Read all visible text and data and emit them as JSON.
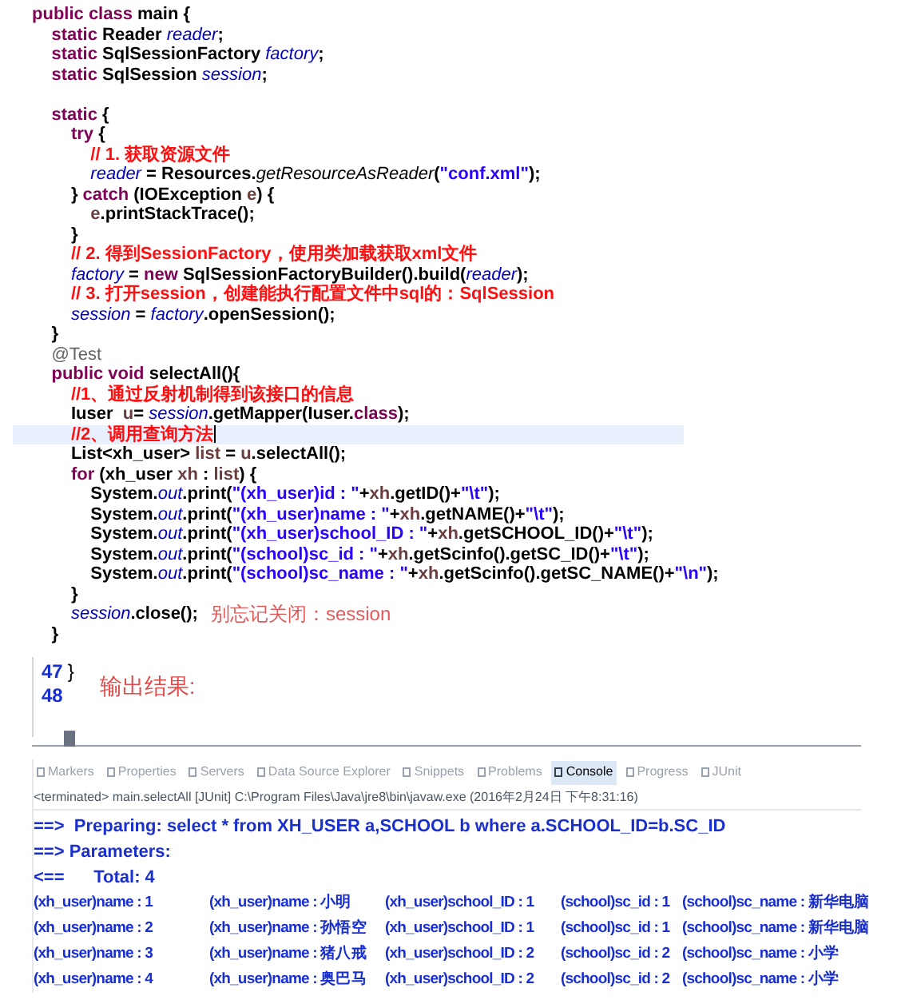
{
  "code_lines": [
    {
      "kind": "code",
      "highlighted": false,
      "tokens": [
        {
          "kind": "kw",
          "text": "public class "
        },
        {
          "kind": "tx",
          "text": "main {"
        }
      ]
    },
    {
      "kind": "code",
      "highlighted": false,
      "tokens": [
        {
          "kind": "kw",
          "text": "    static "
        },
        {
          "kind": "tx",
          "text": "Reader "
        },
        {
          "kind": "fld",
          "text": "reader"
        },
        {
          "kind": "tx",
          "text": ";"
        }
      ]
    },
    {
      "kind": "code",
      "highlighted": false,
      "tokens": [
        {
          "kind": "kw",
          "text": "    static "
        },
        {
          "kind": "tx",
          "text": "SqlSessionFactory "
        },
        {
          "kind": "fld",
          "text": "factory"
        },
        {
          "kind": "tx",
          "text": ";"
        }
      ]
    },
    {
      "kind": "code",
      "highlighted": false,
      "tokens": [
        {
          "kind": "kw",
          "text": "    static "
        },
        {
          "kind": "tx",
          "text": "SqlSession "
        },
        {
          "kind": "fld",
          "text": "session"
        },
        {
          "kind": "tx",
          "text": ";"
        }
      ]
    },
    {
      "kind": "blank"
    },
    {
      "kind": "code",
      "highlighted": false,
      "tokens": [
        {
          "kind": "kw",
          "text": "    static "
        },
        {
          "kind": "tx",
          "text": "{"
        }
      ]
    },
    {
      "kind": "code",
      "highlighted": false,
      "tokens": [
        {
          "kind": "kw",
          "text": "        try "
        },
        {
          "kind": "tx",
          "text": "{"
        }
      ]
    },
    {
      "kind": "code",
      "highlighted": false,
      "tokens": [
        {
          "kind": "cm",
          "text": "            // 1. 获取资源文件"
        }
      ]
    },
    {
      "kind": "code",
      "highlighted": false,
      "tokens": [
        {
          "kind": "fld",
          "text": "            reader"
        },
        {
          "kind": "tx",
          "text": " = Resources."
        },
        {
          "kind": "sm",
          "text": "getResourceAsReader"
        },
        {
          "kind": "tx",
          "text": "("
        },
        {
          "kind": "str",
          "text": "\"conf.xml\""
        },
        {
          "kind": "tx",
          "text": ");"
        }
      ]
    },
    {
      "kind": "code",
      "highlighted": false,
      "tokens": [
        {
          "kind": "tx",
          "text": "        } "
        },
        {
          "kind": "kw",
          "text": "catch "
        },
        {
          "kind": "tx",
          "text": "(IOException "
        },
        {
          "kind": "loc",
          "text": "e"
        },
        {
          "kind": "tx",
          "text": ") {"
        }
      ]
    },
    {
      "kind": "code",
      "highlighted": false,
      "tokens": [
        {
          "kind": "loc",
          "text": "            e"
        },
        {
          "kind": "tx",
          "text": ".printStackTrace();"
        }
      ]
    },
    {
      "kind": "code",
      "highlighted": false,
      "tokens": [
        {
          "kind": "tx",
          "text": "        }"
        }
      ]
    },
    {
      "kind": "code",
      "highlighted": false,
      "tokens": [
        {
          "kind": "cm",
          "text": "        // 2. 得到SessionFactory，使用类加载获取xml文件"
        }
      ]
    },
    {
      "kind": "code",
      "highlighted": false,
      "tokens": [
        {
          "kind": "fld",
          "text": "        factory"
        },
        {
          "kind": "tx",
          "text": " = "
        },
        {
          "kind": "kw",
          "text": "new "
        },
        {
          "kind": "tx",
          "text": "SqlSessionFactoryBuilder().build("
        },
        {
          "kind": "fld",
          "text": "reader"
        },
        {
          "kind": "tx",
          "text": ");"
        }
      ]
    },
    {
      "kind": "code",
      "highlighted": false,
      "tokens": [
        {
          "kind": "cm",
          "text": "        // 3. 打开session，创建能执行配置文件中sql的：SqlSession"
        }
      ]
    },
    {
      "kind": "code",
      "highlighted": false,
      "tokens": [
        {
          "kind": "fld",
          "text": "        session"
        },
        {
          "kind": "tx",
          "text": " = "
        },
        {
          "kind": "fld",
          "text": "factory"
        },
        {
          "kind": "tx",
          "text": ".openSession();"
        }
      ]
    },
    {
      "kind": "code",
      "highlighted": false,
      "tokens": [
        {
          "kind": "tx",
          "text": "    }"
        }
      ]
    },
    {
      "kind": "code",
      "highlighted": false,
      "tokens": [
        {
          "kind": "ann",
          "text": "    @Test"
        }
      ]
    },
    {
      "kind": "code",
      "highlighted": false,
      "tokens": [
        {
          "kind": "kw",
          "text": "    public void "
        },
        {
          "kind": "tx",
          "text": "selectAll(){"
        }
      ]
    },
    {
      "kind": "code",
      "highlighted": false,
      "tokens": [
        {
          "kind": "cm",
          "text": "        //1、通过反射机制得到该接口的信息"
        }
      ]
    },
    {
      "kind": "code",
      "highlighted": false,
      "tokens": [
        {
          "kind": "tx",
          "text": "        Iuser  "
        },
        {
          "kind": "loc",
          "text": "u"
        },
        {
          "kind": "tx",
          "text": "= "
        },
        {
          "kind": "fld",
          "text": "session"
        },
        {
          "kind": "tx",
          "text": ".getMapper(Iuser."
        },
        {
          "kind": "kw",
          "text": "class"
        },
        {
          "kind": "tx",
          "text": ");"
        }
      ]
    },
    {
      "kind": "code",
      "highlighted": true,
      "tokens": [
        {
          "kind": "cm",
          "text": "        //2、调用查询方法"
        }
      ]
    },
    {
      "kind": "code",
      "highlighted": false,
      "tokens": [
        {
          "kind": "tx",
          "text": "        List<xh_user> "
        },
        {
          "kind": "loc",
          "text": "list"
        },
        {
          "kind": "tx",
          "text": " = "
        },
        {
          "kind": "loc",
          "text": "u"
        },
        {
          "kind": "tx",
          "text": ".selectAll();"
        }
      ]
    },
    {
      "kind": "code",
      "highlighted": false,
      "tokens": [
        {
          "kind": "kw",
          "text": "        for "
        },
        {
          "kind": "tx",
          "text": "(xh_user "
        },
        {
          "kind": "loc",
          "text": "xh"
        },
        {
          "kind": "tx",
          "text": " : "
        },
        {
          "kind": "loc",
          "text": "list"
        },
        {
          "kind": "tx",
          "text": ") {"
        }
      ]
    },
    {
      "kind": "code",
      "highlighted": false,
      "tokens": [
        {
          "kind": "tx",
          "text": "            System."
        },
        {
          "kind": "fld",
          "text": "out"
        },
        {
          "kind": "tx",
          "text": ".print("
        },
        {
          "kind": "str",
          "text": "\"(xh_user)id : \""
        },
        {
          "kind": "tx",
          "text": "+"
        },
        {
          "kind": "loc",
          "text": "xh"
        },
        {
          "kind": "tx",
          "text": ".getID()+"
        },
        {
          "kind": "str",
          "text": "\"\\t\""
        },
        {
          "kind": "tx",
          "text": ");"
        }
      ]
    },
    {
      "kind": "code",
      "highlighted": false,
      "tokens": [
        {
          "kind": "tx",
          "text": "            System."
        },
        {
          "kind": "fld",
          "text": "out"
        },
        {
          "kind": "tx",
          "text": ".print("
        },
        {
          "kind": "str",
          "text": "\"(xh_user)name : \""
        },
        {
          "kind": "tx",
          "text": "+"
        },
        {
          "kind": "loc",
          "text": "xh"
        },
        {
          "kind": "tx",
          "text": ".getNAME()+"
        },
        {
          "kind": "str",
          "text": "\"\\t\""
        },
        {
          "kind": "tx",
          "text": ");"
        }
      ]
    },
    {
      "kind": "code",
      "highlighted": false,
      "tokens": [
        {
          "kind": "tx",
          "text": "            System."
        },
        {
          "kind": "fld",
          "text": "out"
        },
        {
          "kind": "tx",
          "text": ".print("
        },
        {
          "kind": "str",
          "text": "\"(xh_user)school_ID : \""
        },
        {
          "kind": "tx",
          "text": "+"
        },
        {
          "kind": "loc",
          "text": "xh"
        },
        {
          "kind": "tx",
          "text": ".getSCHOOL_ID()+"
        },
        {
          "kind": "str",
          "text": "\"\\t\""
        },
        {
          "kind": "tx",
          "text": ");"
        }
      ]
    },
    {
      "kind": "code",
      "highlighted": false,
      "tokens": [
        {
          "kind": "tx",
          "text": "            System."
        },
        {
          "kind": "fld",
          "text": "out"
        },
        {
          "kind": "tx",
          "text": ".print("
        },
        {
          "kind": "str",
          "text": "\"(school)sc_id : \""
        },
        {
          "kind": "tx",
          "text": "+"
        },
        {
          "kind": "loc",
          "text": "xh"
        },
        {
          "kind": "tx",
          "text": ".getScinfo().getSC_ID()+"
        },
        {
          "kind": "str",
          "text": "\"\\t\""
        },
        {
          "kind": "tx",
          "text": ");"
        }
      ]
    },
    {
      "kind": "code",
      "highlighted": false,
      "tokens": [
        {
          "kind": "tx",
          "text": "            System."
        },
        {
          "kind": "fld",
          "text": "out"
        },
        {
          "kind": "tx",
          "text": ".print("
        },
        {
          "kind": "str",
          "text": "\"(school)sc_name : \""
        },
        {
          "kind": "tx",
          "text": "+"
        },
        {
          "kind": "loc",
          "text": "xh"
        },
        {
          "kind": "tx",
          "text": ".getScinfo().getSC_NAME()+"
        },
        {
          "kind": "str",
          "text": "\"\\n\""
        },
        {
          "kind": "tx",
          "text": ");"
        }
      ]
    },
    {
      "kind": "code",
      "highlighted": false,
      "tokens": [
        {
          "kind": "tx",
          "text": "        }"
        }
      ]
    },
    {
      "kind": "code",
      "highlighted": false,
      "tokens": [
        {
          "kind": "fld",
          "text": "        session"
        },
        {
          "kind": "tx",
          "text": ".close();"
        }
      ],
      "note": "别忘记关闭：session"
    },
    {
      "kind": "code",
      "highlighted": false,
      "tokens": [
        {
          "kind": "tx",
          "text": "    }"
        }
      ]
    }
  ],
  "editor_tail": {
    "lines": [
      {
        "number": "47",
        "text": "}"
      },
      {
        "number": "48"
      }
    ],
    "note": "输出结果:"
  },
  "console": {
    "tabs": [
      {
        "label": "Markers",
        "selected": false
      },
      {
        "label": "Properties",
        "selected": false
      },
      {
        "label": "Servers",
        "selected": false
      },
      {
        "label": "Data Source Explorer",
        "selected": false
      },
      {
        "label": "Snippets",
        "selected": false
      },
      {
        "label": "Problems",
        "selected": false
      },
      {
        "label": "Console",
        "selected": true
      },
      {
        "label": "Progress",
        "selected": false
      },
      {
        "label": "JUnit",
        "selected": false
      }
    ],
    "status": "<terminated> main.selectAll [JUnit] C:\\Program Files\\Java\\jre8\\bin\\javaw.exe (2016年2月24日 下午8:31:16)",
    "lines": [
      "==>  Preparing: select * from XH_USER a,SCHOOL b where a.SCHOOL_ID=b.SC_ID",
      "==> Parameters: ",
      "<==      Total: 4"
    ],
    "rows": [
      {
        "cells": [
          "(xh_user)name : 1",
          "(xh_user)name : 小明",
          "(xh_user)school_ID : 1",
          "(school)sc_id : 1",
          "(school)sc_name : 新华电脑"
        ]
      },
      {
        "cells": [
          "(xh_user)name : 2",
          "(xh_user)name : 孙悟空",
          "(xh_user)school_ID : 1",
          "(school)sc_id : 1",
          "(school)sc_name : 新华电脑"
        ]
      },
      {
        "cells": [
          "(xh_user)name : 3",
          "(xh_user)name : 猪八戒",
          "(xh_user)school_ID : 2",
          "(school)sc_id : 2",
          "(school)sc_name : 小学"
        ]
      },
      {
        "cells": [
          "(xh_user)name : 4",
          "(xh_user)name : 奥巴马",
          "(xh_user)school_ID : 2",
          "(school)sc_id : 2",
          "(school)sc_name : 小学"
        ]
      }
    ]
  }
}
